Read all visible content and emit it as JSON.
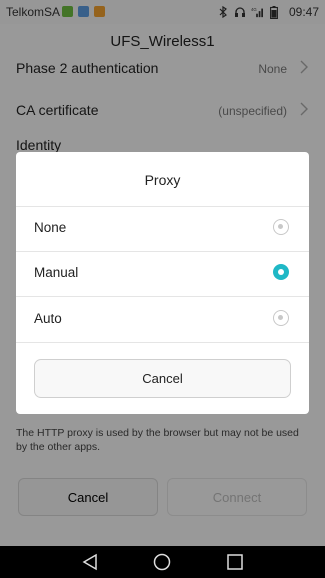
{
  "status_bar": {
    "carrier": "TelkomSA",
    "network_label": "4G",
    "time": "09:47",
    "notification_colors": [
      "#6dbb3f",
      "#5d9cdf",
      "#f0a030"
    ]
  },
  "header": {
    "title": "UFS_Wireless1"
  },
  "settings": {
    "phase2": {
      "label": "Phase 2 authentication",
      "value": "None"
    },
    "ca_cert": {
      "label": "CA certificate",
      "value": "(unspecified)"
    },
    "identity": {
      "label": "Identity"
    }
  },
  "hint_text": "The HTTP proxy is used by the browser but may not be used by the other apps.",
  "footer_buttons": {
    "cancel": "Cancel",
    "connect": "Connect"
  },
  "dialog": {
    "title": "Proxy",
    "options": [
      {
        "label": "None",
        "selected": false
      },
      {
        "label": "Manual",
        "selected": true
      },
      {
        "label": "Auto",
        "selected": false
      }
    ],
    "cancel_label": "Cancel",
    "accent_color": "#1fb8c6"
  },
  "nav_icons": [
    "back-icon",
    "home-icon",
    "recents-icon"
  ]
}
